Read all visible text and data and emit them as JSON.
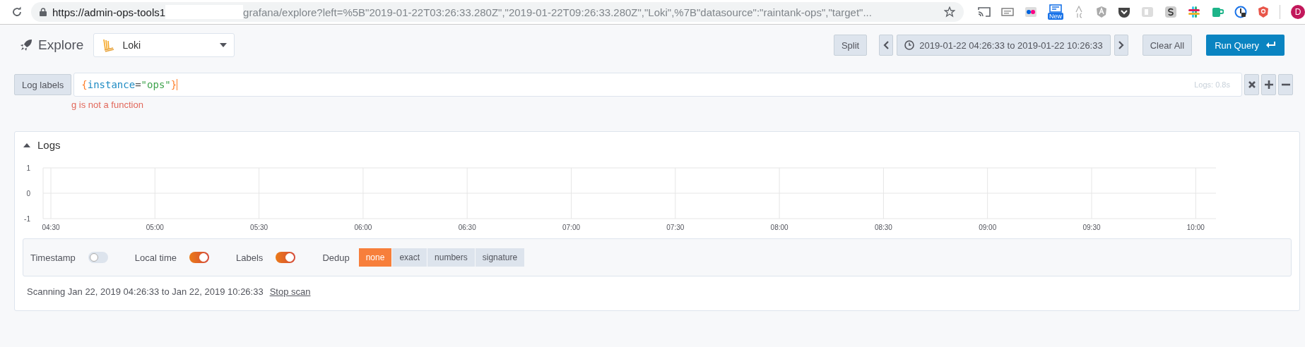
{
  "browser": {
    "url_start": "https://admin-ops-tools1",
    "url_rest": "grafana/explore?left=%5B\"2019-01-22T03:26:33.280Z\",\"2019-01-22T09:26:33.280Z\",\"Loki\",%7B\"datasource\":\"raintank-ops\",\"target\"...",
    "new_badge": "New",
    "avatar": "D"
  },
  "header": {
    "title": "Explore",
    "datasource": "Loki",
    "split": "Split",
    "time_range": "2019-01-22 04:26:33 to 2019-01-22 10:26:33",
    "clear": "Clear All",
    "run": "Run Query"
  },
  "query": {
    "labels_button": "Log labels",
    "tokens": [
      {
        "text": "{",
        "kind": "brace"
      },
      {
        "text": "instance",
        "kind": "key"
      },
      {
        "text": "=",
        "kind": "op"
      },
      {
        "text": "\"ops\"",
        "kind": "string"
      },
      {
        "text": "}",
        "kind": "brace"
      }
    ],
    "timing": "Logs: 0.8s",
    "error": "g is not a function"
  },
  "logs": {
    "title": "Logs",
    "expanded": true,
    "chart_data": {
      "type": "line",
      "grid": true,
      "yticks": [
        -1,
        0,
        1
      ],
      "ylim": [
        -1,
        1
      ],
      "categories": [
        "04:30",
        "05:00",
        "05:30",
        "06:00",
        "06:30",
        "07:00",
        "07:30",
        "08:00",
        "08:30",
        "09:00",
        "09:30",
        "10:00"
      ]
    },
    "switches": [
      {
        "label": "Timestamp",
        "on": false
      },
      {
        "label": "Local time",
        "on": true
      },
      {
        "label": "Labels",
        "on": true
      }
    ],
    "dedup_label": "Dedup",
    "dedup": [
      {
        "label": "none",
        "selected": true
      },
      {
        "label": "exact",
        "selected": false
      },
      {
        "label": "numbers",
        "selected": false
      },
      {
        "label": "signature",
        "selected": false
      }
    ],
    "status": "Scanning Jan 22, 2019 04:26:33 to Jan 22, 2019 10:26:33",
    "stop": "Stop scan"
  }
}
